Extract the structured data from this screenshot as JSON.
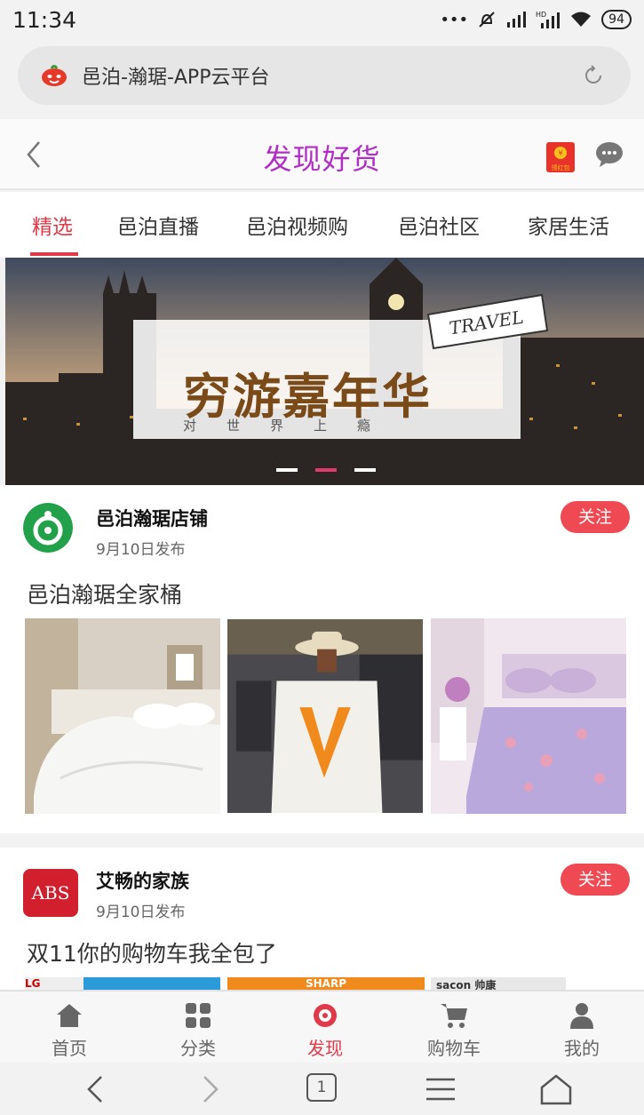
{
  "status_bar": {
    "time": "11:34",
    "battery": "94"
  },
  "url_bar": {
    "url_text": "邑泊-瀚琚-APP云平台"
  },
  "header": {
    "title": "发现好货",
    "redpacket_label": "领红包"
  },
  "tabs": [
    {
      "label": "精选",
      "active": true
    },
    {
      "label": "邑泊直播",
      "active": false
    },
    {
      "label": "邑泊视频购",
      "active": false
    },
    {
      "label": "邑泊社区",
      "active": false
    },
    {
      "label": "家居生活",
      "active": false
    }
  ],
  "banner": {
    "title": "穷游嘉年华",
    "subtitle": "对世界上瘾",
    "tag": "TRAVEL",
    "active_dot": 1,
    "dot_count": 3
  },
  "posts": [
    {
      "shop_name": "邑泊瀚琚店铺",
      "date": "9月10日发布",
      "follow_label": "关注",
      "text": "邑泊瀚琚全家桶"
    },
    {
      "shop_name": "艾畅的家族",
      "avatar_text": "ABS",
      "date": "9月10日发布",
      "follow_label": "关注",
      "text": "双11你的购物车我全包了",
      "strip_labels": [
        "LG",
        "SHARP",
        "sacon 帅康"
      ]
    }
  ],
  "bottom_nav": [
    {
      "label": "首页",
      "icon": "home-icon",
      "active": false
    },
    {
      "label": "分类",
      "icon": "grid-icon",
      "active": false
    },
    {
      "label": "发现",
      "icon": "discover-icon",
      "active": true
    },
    {
      "label": "购物车",
      "icon": "cart-icon",
      "active": false
    },
    {
      "label": "我的",
      "icon": "person-icon",
      "active": false
    }
  ],
  "system_nav": {
    "tab_count": "1"
  },
  "colors": {
    "accent": "#e03a4a",
    "title": "#b12ec6",
    "follow": "#ef4a54"
  }
}
